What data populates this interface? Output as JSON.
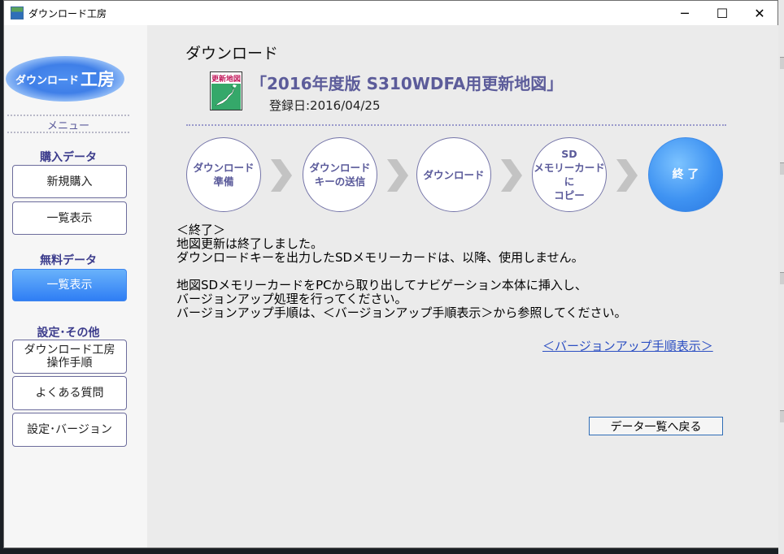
{
  "window": {
    "title": "ダウンロード工房",
    "minimize_glyph": "─",
    "maximize_glyph": "☐",
    "close_glyph": "✕"
  },
  "sidebar": {
    "logo_small": "ダウンロード",
    "logo_big": "工房",
    "menu_label": "メニュー",
    "purchase_label": "購入データ",
    "purchase_items": [
      {
        "label": "新規購入"
      },
      {
        "label": "一覧表示"
      }
    ],
    "free_label": "無料データ",
    "free_items": [
      {
        "label": "一覧表示",
        "active": true
      }
    ],
    "settings_label": "設定･その他",
    "settings_items": [
      {
        "label": "ダウンロード工房\n操作手順"
      },
      {
        "label": "よくある質問"
      },
      {
        "label": "設定･バージョン"
      }
    ]
  },
  "main": {
    "title": "ダウンロード",
    "map_icon_label": "更新地図",
    "product_name": "「2016年度版 S310WDFA用更新地図」",
    "registration_date": "登録日:2016/04/25",
    "steps": [
      {
        "label": "ダウンロード\n準備",
        "state": "pending"
      },
      {
        "label": "ダウンロード\nキーの送信",
        "state": "pending"
      },
      {
        "label": "ダウンロード",
        "state": "pending"
      },
      {
        "label": "SD\nメモリーカードに\nコピー",
        "state": "pending"
      },
      {
        "label": "終 了",
        "state": "current"
      }
    ],
    "message": {
      "heading": "＜終了＞",
      "line1": "地図更新は終了しました。",
      "line2": "ダウンロードキーを出力したSDメモリーカードは、以降、使用しません。",
      "line3": "地図SDメモリーカードをPCから取り出してナビゲーション本体に挿入し、",
      "line4": "バージョンアップ処理を行ってください。",
      "line5": "バージョンアップ手順は、＜バージョンアップ手順表示＞から参照してください。"
    },
    "link_label": "＜バージョンアップ手順表示＞",
    "back_button": "データ一覧へ戻る"
  }
}
